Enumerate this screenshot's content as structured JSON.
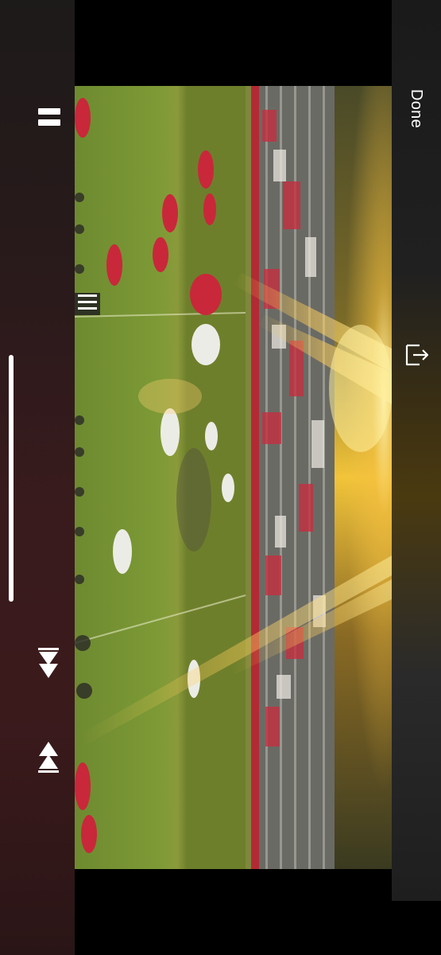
{
  "player": {
    "done_label": "Done",
    "progress": 1.0
  },
  "controls": {
    "pause_icon": "pause-icon",
    "skip_back_icon": "skip-back-icon",
    "skip_forward_icon": "skip-forward-icon",
    "share_icon": "share-icon"
  },
  "colors": {
    "control_bar": "#3a1b1d",
    "icon": "#ffffff",
    "field": "#6b8a30",
    "home_team": "#c8283a",
    "away_team": "#e8e8e8"
  }
}
